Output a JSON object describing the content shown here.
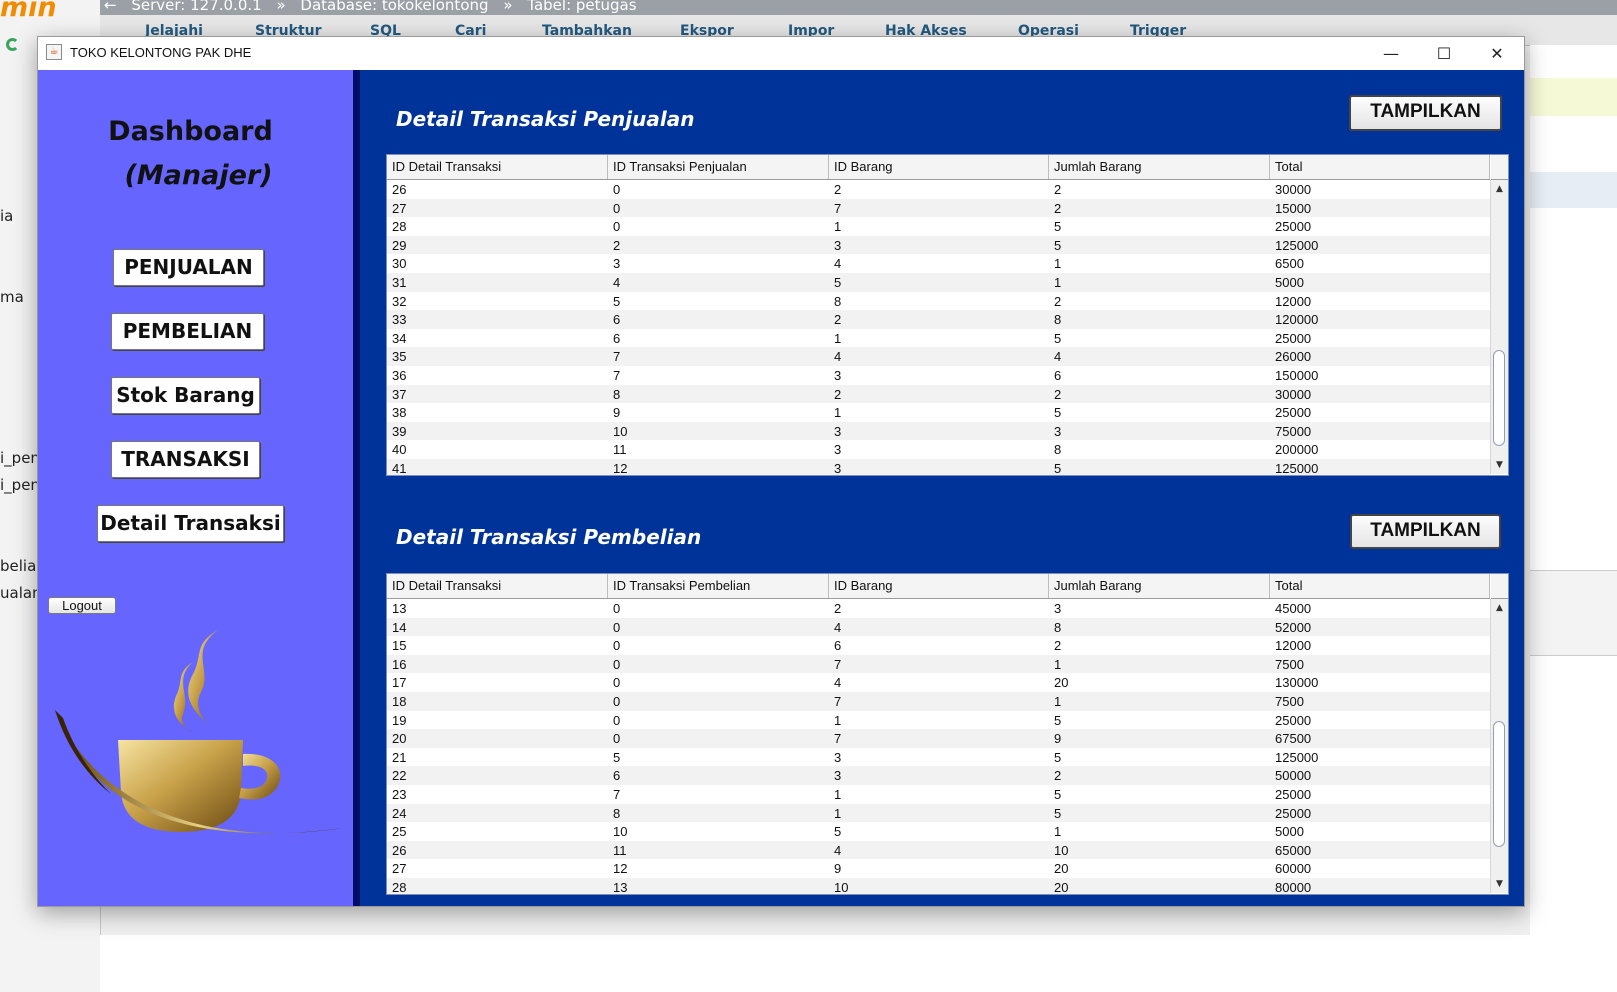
{
  "background": {
    "logo_text": "min",
    "breadcrumb": [
      "Server: 127.0.0.1",
      "»",
      "Database: tokokelontong",
      "»",
      "Tabel: petugas"
    ],
    "tabs": [
      "Jelajahi",
      "Struktur",
      "SQL",
      "Cari",
      "Tambahkan",
      "Ekspor",
      "Impor",
      "Hak Akses",
      "Operasi",
      "Trigger"
    ],
    "side_texts": [
      "ia",
      "ma",
      "i_pem",
      "i_pen",
      "belian",
      "ualan"
    ]
  },
  "window": {
    "title": "TOKO KELONTONG PAK DHE",
    "minimize_glyph": "—",
    "maximize_glyph": "☐",
    "close_glyph": "✕"
  },
  "sidebar": {
    "title": "Dashboard",
    "subtitle": "(Manajer)",
    "buttons": [
      "PENJUALAN",
      "PEMBELIAN",
      "Stok Barang",
      "TRANSAKSI",
      "Detail Transaksi"
    ],
    "logout": "Logout"
  },
  "penjualan": {
    "title": "Detail Transaksi Penjualan",
    "button": "TAMPILKAN",
    "columns": [
      "ID Detail Transaksi",
      "ID Transaksi Penjualan",
      "ID Barang",
      "Jumlah Barang",
      "Total"
    ],
    "rows": [
      [
        "26",
        "0",
        "2",
        "2",
        "30000"
      ],
      [
        "27",
        "0",
        "7",
        "2",
        "15000"
      ],
      [
        "28",
        "0",
        "1",
        "5",
        "25000"
      ],
      [
        "29",
        "2",
        "3",
        "5",
        "125000"
      ],
      [
        "30",
        "3",
        "4",
        "1",
        "6500"
      ],
      [
        "31",
        "4",
        "5",
        "1",
        "5000"
      ],
      [
        "32",
        "5",
        "8",
        "2",
        "12000"
      ],
      [
        "33",
        "6",
        "2",
        "8",
        "120000"
      ],
      [
        "34",
        "6",
        "1",
        "5",
        "25000"
      ],
      [
        "35",
        "7",
        "4",
        "4",
        "26000"
      ],
      [
        "36",
        "7",
        "3",
        "6",
        "150000"
      ],
      [
        "37",
        "8",
        "2",
        "2",
        "30000"
      ],
      [
        "38",
        "9",
        "1",
        "5",
        "25000"
      ],
      [
        "39",
        "10",
        "3",
        "3",
        "75000"
      ],
      [
        "40",
        "11",
        "3",
        "8",
        "200000"
      ],
      [
        "41",
        "12",
        "3",
        "5",
        "125000"
      ]
    ]
  },
  "pembelian": {
    "title": "Detail Transaksi Pembelian",
    "button": "TAMPILKAN",
    "columns": [
      "ID Detail Transaksi",
      "ID Transaksi Pembelian",
      "ID Barang",
      "Jumlah Barang",
      "Total"
    ],
    "rows": [
      [
        "13",
        "0",
        "2",
        "3",
        "45000"
      ],
      [
        "14",
        "0",
        "4",
        "8",
        "52000"
      ],
      [
        "15",
        "0",
        "6",
        "2",
        "12000"
      ],
      [
        "16",
        "0",
        "7",
        "1",
        "7500"
      ],
      [
        "17",
        "0",
        "4",
        "20",
        "130000"
      ],
      [
        "18",
        "0",
        "7",
        "1",
        "7500"
      ],
      [
        "19",
        "0",
        "1",
        "5",
        "25000"
      ],
      [
        "20",
        "0",
        "7",
        "9",
        "67500"
      ],
      [
        "21",
        "5",
        "3",
        "5",
        "125000"
      ],
      [
        "22",
        "6",
        "3",
        "2",
        "50000"
      ],
      [
        "23",
        "7",
        "1",
        "5",
        "25000"
      ],
      [
        "24",
        "8",
        "1",
        "5",
        "25000"
      ],
      [
        "25",
        "10",
        "5",
        "1",
        "5000"
      ],
      [
        "26",
        "11",
        "4",
        "10",
        "65000"
      ],
      [
        "27",
        "12",
        "9",
        "20",
        "60000"
      ],
      [
        "28",
        "13",
        "10",
        "20",
        "80000"
      ]
    ]
  },
  "colors": {
    "sidebar": "#6666ff",
    "main": "#003399",
    "divider": "#000c66"
  }
}
